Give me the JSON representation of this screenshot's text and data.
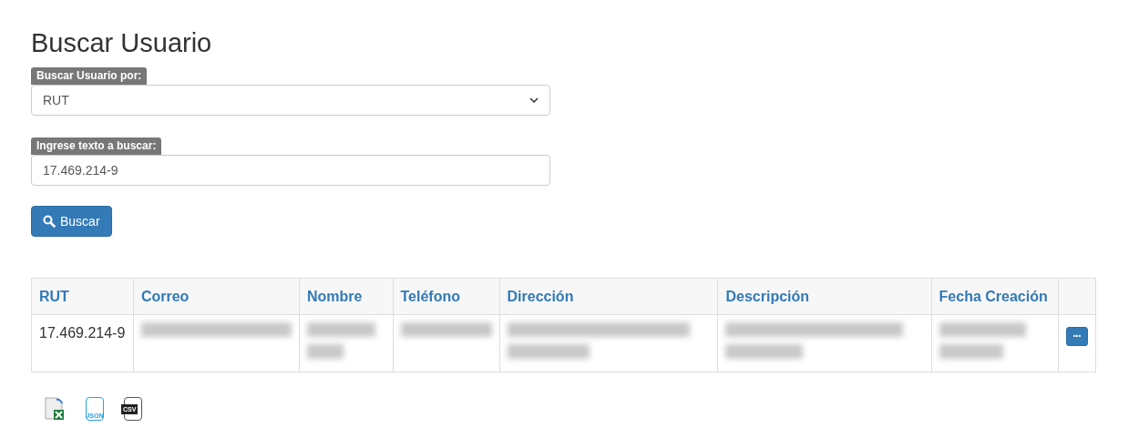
{
  "title": "Buscar Usuario",
  "search_by": {
    "label": "Buscar Usuario por:",
    "value": "RUT"
  },
  "search_text": {
    "label": "Ingrese texto a buscar:",
    "value": "17.469.214-9"
  },
  "search_button": {
    "label": "Buscar"
  },
  "table": {
    "columns": [
      "RUT",
      "Correo",
      "Nombre",
      "Teléfono",
      "Dirección",
      "Descripción",
      "Fecha Creación"
    ],
    "rows": [
      {
        "cells": [
          {
            "kind": "text",
            "text": "17.469.214-9"
          },
          {
            "kind": "blurred"
          },
          {
            "kind": "blurred"
          },
          {
            "kind": "blurred"
          },
          {
            "kind": "blurred"
          },
          {
            "kind": "blurred"
          },
          {
            "kind": "blurred"
          }
        ],
        "action": {
          "label": "•••"
        }
      }
    ]
  },
  "exports": [
    {
      "kind": "excel"
    },
    {
      "kind": "json",
      "label": "JSON"
    },
    {
      "kind": "csv",
      "label": "CSV"
    }
  ]
}
